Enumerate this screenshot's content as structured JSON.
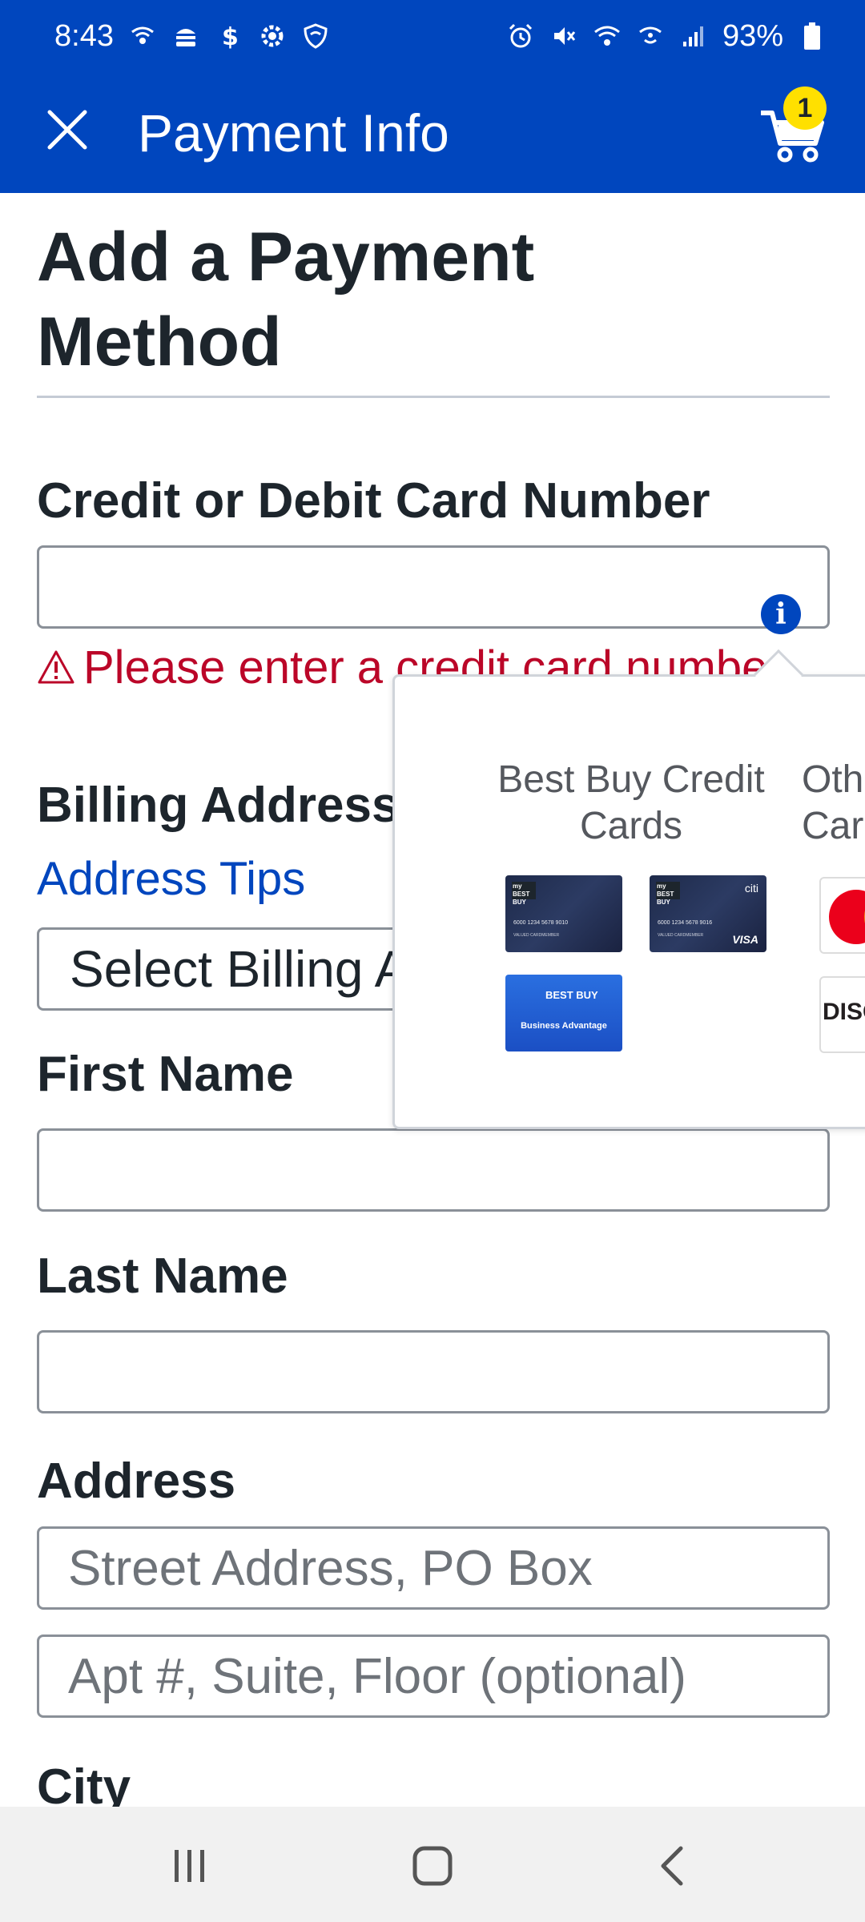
{
  "status_bar": {
    "time": "8:43",
    "battery": "93%"
  },
  "app_bar": {
    "title": "Payment Info",
    "cart_count": "1"
  },
  "page": {
    "title": "Add a Payment Method"
  },
  "card_number": {
    "label": "Credit or Debit Card Number",
    "value": "",
    "error": "Please enter a credit card number"
  },
  "billing": {
    "label": "Billing Address",
    "tips_link": "Address Tips",
    "select_value": "Select Billing Address"
  },
  "first_name": {
    "label": "First Name",
    "value": ""
  },
  "last_name": {
    "label": "Last Name",
    "value": ""
  },
  "address": {
    "label": "Address",
    "street_placeholder": "Street Address, PO Box",
    "apt_placeholder": "Apt #, Suite, Floor (optional)"
  },
  "city": {
    "label": "City"
  },
  "popover": {
    "bby_heading": "Best Buy Credit Cards",
    "other_heading": "Other Cards",
    "card1_logo": "my BEST BUY",
    "card1_number": "6000 1234 5678 9010",
    "card1_sub": "VALUED CARDMEMBER",
    "card2_logo": "my BEST BUY",
    "card2_number": "6000 1234 5678 9016",
    "card2_sub": "VALUED CARDMEMBER",
    "card2_brand": "VISA",
    "card2_issuer": "citi",
    "card3_logo": "BEST BUY",
    "card3_text": "Business Advantage",
    "discover_text": "DISCOVER"
  },
  "colors": {
    "brand_blue": "#0046be",
    "error_red": "#bb0628",
    "badge_yellow": "#ffe000"
  }
}
